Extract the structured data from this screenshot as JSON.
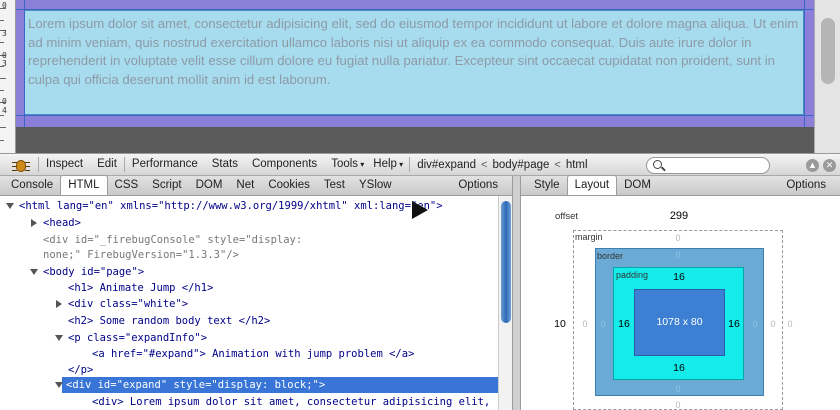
{
  "page": {
    "paragraph": "Lorem ipsum dolor sit amet, consectetur adipisicing elit, sed do eiusmod tempor incididunt ut labore et dolore magna aliqua. Ut enim ad minim veniam, quis nostrud exercitation ullamco laboris nisi ut aliquip ex ea commodo consequat. Duis aute irure dolor in reprehenderit in voluptate velit esse cillum dolore eu fugiat nulla pariatur. Excepteur sint occaecat cupidatat non proident, sunt in culpa qui officia deserunt mollit anim id est laborum.",
    "ruler_labels": [
      "0",
      "3",
      "0",
      "3",
      "5",
      "0",
      "4",
      "0"
    ]
  },
  "toolbar": {
    "inspect": "Inspect",
    "edit": "Edit",
    "performance": "Performance",
    "stats": "Stats",
    "components": "Components",
    "tools": "Tools",
    "help": "Help",
    "breadcrumb": [
      "div#expand",
      "body#page",
      "html"
    ],
    "crumb_sep": "<",
    "search_value": ""
  },
  "left_tabs": [
    "Console",
    "HTML",
    "CSS",
    "Script",
    "DOM",
    "Net",
    "Cookies",
    "Test",
    "YSlow"
  ],
  "left_active_tab": "HTML",
  "left_options": "Options",
  "right_tabs": [
    "Style",
    "Layout",
    "DOM"
  ],
  "right_active_tab": "Layout",
  "right_options": "Options",
  "tree": {
    "html_open": "<html lang=\"en\" xmlns=\"http://www.w3.org/1999/xhtml\" xml:lang=\"en\">",
    "head": "<head>",
    "fbconsole_line1": "<div id=\"_firebugConsole\" style=\"display:",
    "fbconsole_line2": "none;\" FirebugVersion=\"1.3.3\"/>",
    "body_open": "<body id=\"page\">",
    "h1": "<h1> Animate Jump </h1>",
    "div_white": "<div class=\"white\">",
    "h2": "<h2> Some random body text </h2>",
    "p_open": "<p class=\"expandInfo\">",
    "a_line": "<a href=\"#expand\"> Animation with jump problem </a>",
    "p_close": "</p>",
    "div_expand": "<div id=\"expand\" style=\"display: block;\">",
    "div_lorem": "<div> Lorem ipsum dolor sit amet, consectetur adipisicing elit,"
  },
  "layout": {
    "offset_label": "offset",
    "offset_value": "299",
    "margin_label": "margin",
    "border_label": "border",
    "padding_label": "padding",
    "margin_left_outer": "10",
    "padding_top": "16",
    "padding_bottom": "16",
    "padding_left": "16",
    "padding_right": "16",
    "content_size": "1078 x 80",
    "zero": "0"
  },
  "colors": {
    "margin_highlight": "#8b7fd9",
    "content_highlight": "#a6dcee",
    "selected_row": "#3875d7",
    "layout_border": "#6aaad5",
    "layout_padding": "#14eceb",
    "layout_content": "#3d7fd3"
  }
}
